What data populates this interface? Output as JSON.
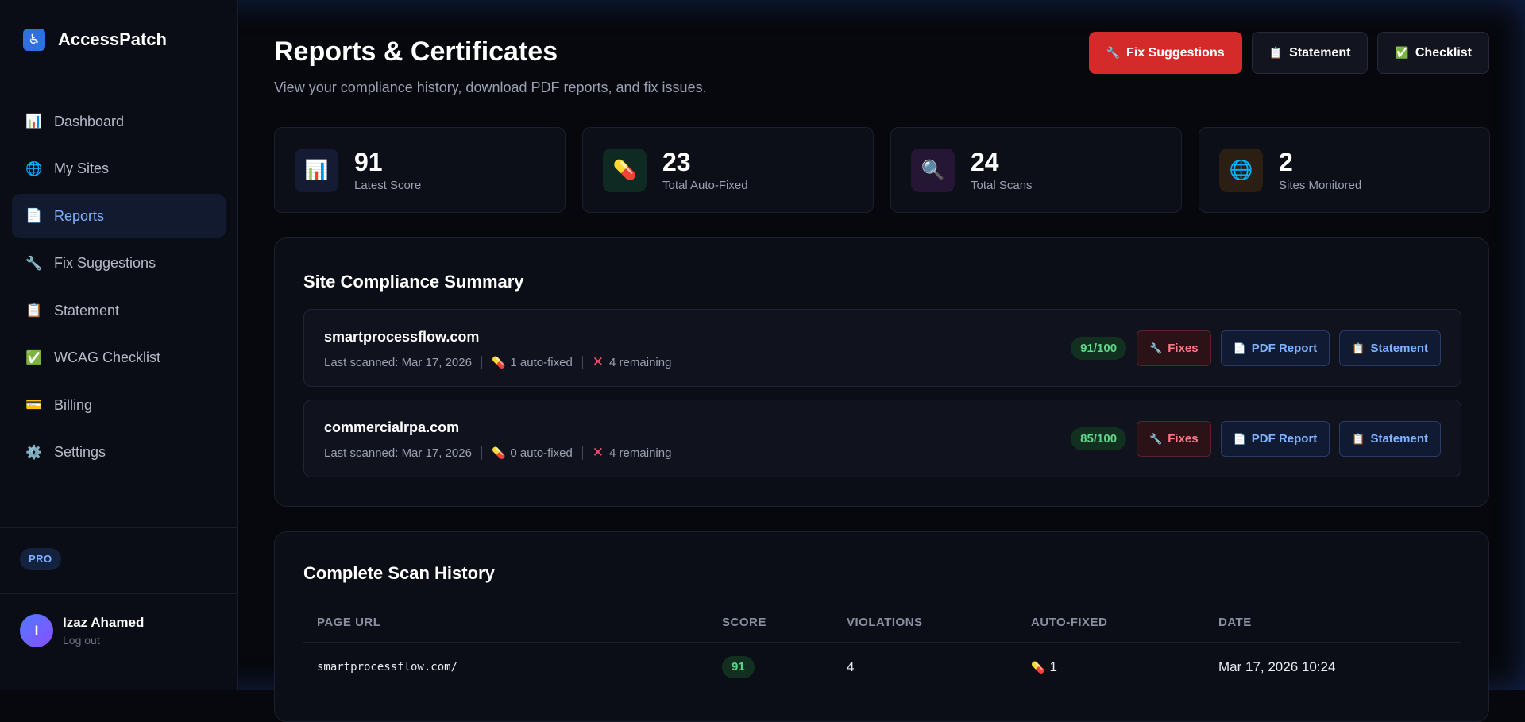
{
  "brand": {
    "name": "AccessPatch",
    "icon": "wheelchair-icon"
  },
  "sidebar": {
    "items": [
      {
        "label": "Dashboard",
        "icon": "bar-chart-icon",
        "glyph": "📊",
        "active": false
      },
      {
        "label": "My Sites",
        "icon": "globe-icon",
        "glyph": "🌐",
        "active": false
      },
      {
        "label": "Reports",
        "icon": "document-icon",
        "glyph": "📄",
        "active": true
      },
      {
        "label": "Fix Suggestions",
        "icon": "wrench-icon",
        "glyph": "🔧",
        "active": false
      },
      {
        "label": "Statement",
        "icon": "clipboard-icon",
        "glyph": "📋",
        "active": false
      },
      {
        "label": "WCAG Checklist",
        "icon": "checkbox-icon",
        "glyph": "✅",
        "active": false
      },
      {
        "label": "Billing",
        "icon": "credit-card-icon",
        "glyph": "💳",
        "active": false
      },
      {
        "label": "Settings",
        "icon": "gear-icon",
        "glyph": "⚙️",
        "active": false
      }
    ],
    "plan_badge": "PRO",
    "user": {
      "initial": "I",
      "name": "Izaz Ahamed",
      "logout": "Log out"
    }
  },
  "header": {
    "title": "Reports & Certificates",
    "subtitle": "View your compliance history, download PDF reports, and fix issues.",
    "buttons": {
      "fix_suggestions": "Fix Suggestions",
      "statement": "Statement",
      "checklist": "Checklist"
    }
  },
  "stats": [
    {
      "value": "91",
      "label": "Latest Score",
      "icon": "bar-chart-icon",
      "glyph": "📊",
      "bg": "#141b33"
    },
    {
      "value": "23",
      "label": "Total Auto-Fixed",
      "icon": "pill-icon",
      "glyph": "💊",
      "bg": "#0f2a22"
    },
    {
      "value": "24",
      "label": "Total Scans",
      "icon": "magnifier-icon",
      "glyph": "🔍",
      "bg": "#241634"
    },
    {
      "value": "2",
      "label": "Sites Monitored",
      "icon": "globe-icon",
      "glyph": "🌐",
      "bg": "#2b1e12"
    }
  ],
  "summary": {
    "title": "Site Compliance Summary",
    "sites": [
      {
        "domain": "smartprocessflow.com",
        "last_scanned": "Last scanned: Mar 17, 2026",
        "auto_fixed": "1 auto-fixed",
        "remaining": "4 remaining",
        "score": "91/100",
        "fixes_label": "Fixes",
        "pdf_label": "PDF Report",
        "statement_label": "Statement"
      },
      {
        "domain": "commercialrpa.com",
        "last_scanned": "Last scanned: Mar 17, 2026",
        "auto_fixed": "0 auto-fixed",
        "remaining": "4 remaining",
        "score": "85/100",
        "fixes_label": "Fixes",
        "pdf_label": "PDF Report",
        "statement_label": "Statement"
      }
    ]
  },
  "history": {
    "title": "Complete Scan History",
    "columns": [
      "PAGE URL",
      "SCORE",
      "VIOLATIONS",
      "AUTO-FIXED",
      "DATE"
    ],
    "rows": [
      {
        "url": "smartprocessflow.com/",
        "score": "91",
        "violations": "4",
        "auto_fixed": "1",
        "date": "Mar 17, 2026 10:24"
      }
    ]
  },
  "colors": {
    "accent": "#2f6fe0",
    "danger": "#d42a2a",
    "success": "#5fd68a"
  }
}
